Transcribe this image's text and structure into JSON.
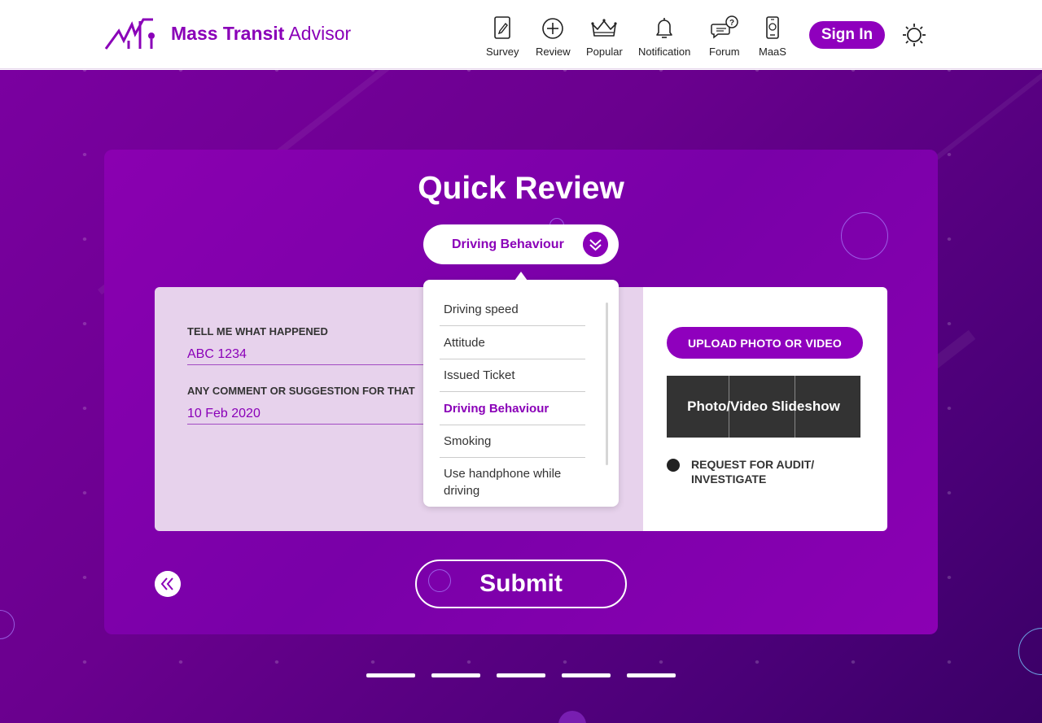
{
  "header": {
    "brand_bold": "Mass Transit",
    "brand_light": "Advisor",
    "nav": [
      {
        "label": "Survey",
        "icon": "survey-icon"
      },
      {
        "label": "Review",
        "icon": "plus-circle-icon"
      },
      {
        "label": "Popular",
        "icon": "crown-icon"
      },
      {
        "label": "Notification",
        "icon": "bell-icon"
      },
      {
        "label": "Forum",
        "icon": "chat-question-icon"
      },
      {
        "label": "MaaS",
        "icon": "phone-icon"
      }
    ],
    "sign_in": "Sign In",
    "theme_icon": "sun-icon"
  },
  "page_title": "Quick Review",
  "category_select": {
    "selected": "Driving Behaviour",
    "options": [
      "Driving speed",
      "Attitude",
      "Issued Ticket",
      "Driving Behaviour",
      "Smoking",
      "Use handphone while driving"
    ]
  },
  "form": {
    "field1": {
      "label": "TELL ME WHAT HAPPENED",
      "value": "ABC 1234"
    },
    "field2": {
      "label": "ANY COMMENT OR SUGGESTION FOR THAT",
      "value": "10 Feb 2020"
    }
  },
  "media": {
    "upload_label": "UPLOAD PHOTO OR VIDEO",
    "slideshow_label": "Photo/Video Slideshow",
    "audit_label": "REQUEST FOR AUDIT/ INVESTIGATE"
  },
  "submit_label": "Submit",
  "colors": {
    "brand": "#8a00b8",
    "background": "#6a008e"
  }
}
